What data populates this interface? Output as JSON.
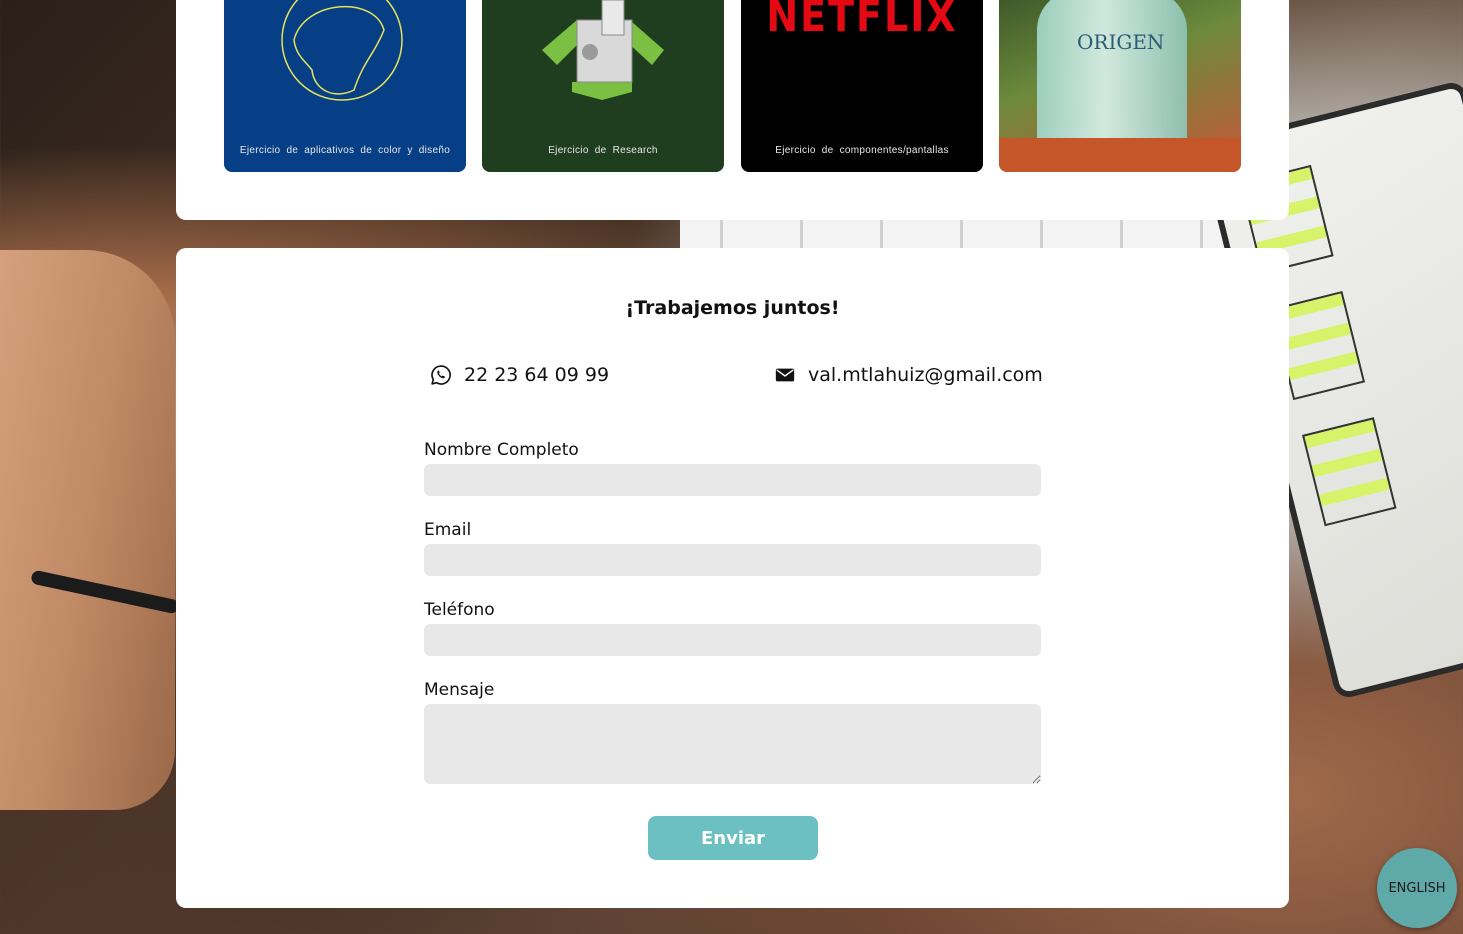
{
  "portfolio": {
    "thumbnails": [
      {
        "caption": "Ejercicio de aplicativos de color y diseño"
      },
      {
        "caption": "Ejercicio de Research"
      },
      {
        "caption": "Ejercicio de componentes/pantallas",
        "logo_text": "NETFLIX"
      },
      {
        "caption": "",
        "logo_text": "ORIGEN"
      }
    ]
  },
  "contact": {
    "title": "¡Trabajemos juntos!",
    "phone": "22 23 64 09 99",
    "email": "val.mtlahuiz@gmail.com",
    "phone_icon": "whatsapp-icon",
    "email_icon": "envelope-icon"
  },
  "form": {
    "name_label": "Nombre Completo",
    "name_value": "",
    "email_label": "Email",
    "email_value": "",
    "phone_label": "Teléfono",
    "phone_value": "",
    "message_label": "Mensaje",
    "message_value": "",
    "submit_label": "Enviar"
  },
  "language_toggle": {
    "label": "ENGLISH"
  },
  "colors": {
    "accent": "#6cc0c2",
    "input_bg": "#e8e8e8",
    "language_button": "#5fa9a8",
    "netflix_red": "#e50914"
  }
}
